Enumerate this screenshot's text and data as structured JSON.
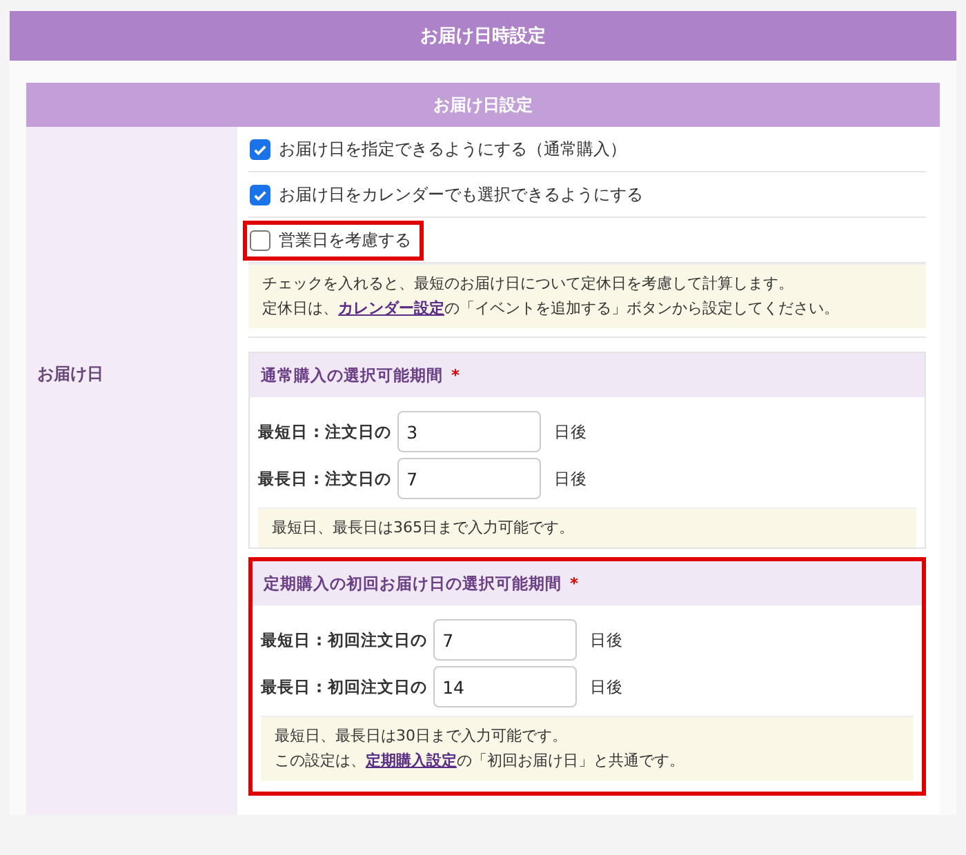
{
  "title": "お届け日時設定",
  "panel": {
    "header": "お届け日設定",
    "label": "お届け日",
    "checkboxes": [
      {
        "label": "お届け日を指定できるようにする（通常購入）",
        "checked": true,
        "highlighted": false
      },
      {
        "label": "お届け日をカレンダーでも選択できるようにする",
        "checked": true,
        "highlighted": false
      },
      {
        "label": "営業日を考慮する",
        "checked": false,
        "highlighted": true
      }
    ],
    "note": [
      [
        {
          "kind": "text",
          "text": "チェックを入れると、最短のお届け日について定休日を考慮して計算します。"
        }
      ],
      [
        {
          "kind": "text",
          "text": "定休日は、"
        },
        {
          "kind": "link",
          "text": "カレンダー設定"
        },
        {
          "kind": "text",
          "text": "の「イベントを追加する」ボタンから設定してください。"
        }
      ]
    ],
    "sections": [
      {
        "title": "通常購入の選択可能期間",
        "required_mark": "*",
        "highlighted": false,
        "fields": [
          {
            "label": "最短日 : 注文日の",
            "value": "3",
            "suffix": "日後"
          },
          {
            "label": "最長日 : 注文日の",
            "value": "7",
            "suffix": "日後"
          }
        ],
        "note": [
          [
            {
              "kind": "text",
              "text": "最短日、最長日は365日まで入力可能です。"
            }
          ]
        ]
      },
      {
        "title": "定期購入の初回お届け日の選択可能期間",
        "required_mark": "*",
        "highlighted": true,
        "fields": [
          {
            "label": "最短日 : 初回注文日の",
            "value": "7",
            "suffix": "日後"
          },
          {
            "label": "最長日 : 初回注文日の",
            "value": "14",
            "suffix": "日後"
          }
        ],
        "note": [
          [
            {
              "kind": "text",
              "text": "最短日、最長日は30日まで入力可能です。"
            }
          ],
          [
            {
              "kind": "text",
              "text": "この設定は、"
            },
            {
              "kind": "link",
              "text": "定期購入設定"
            },
            {
              "kind": "text",
              "text": "の「初回お届け日」と共通です。"
            }
          ]
        ]
      }
    ]
  }
}
